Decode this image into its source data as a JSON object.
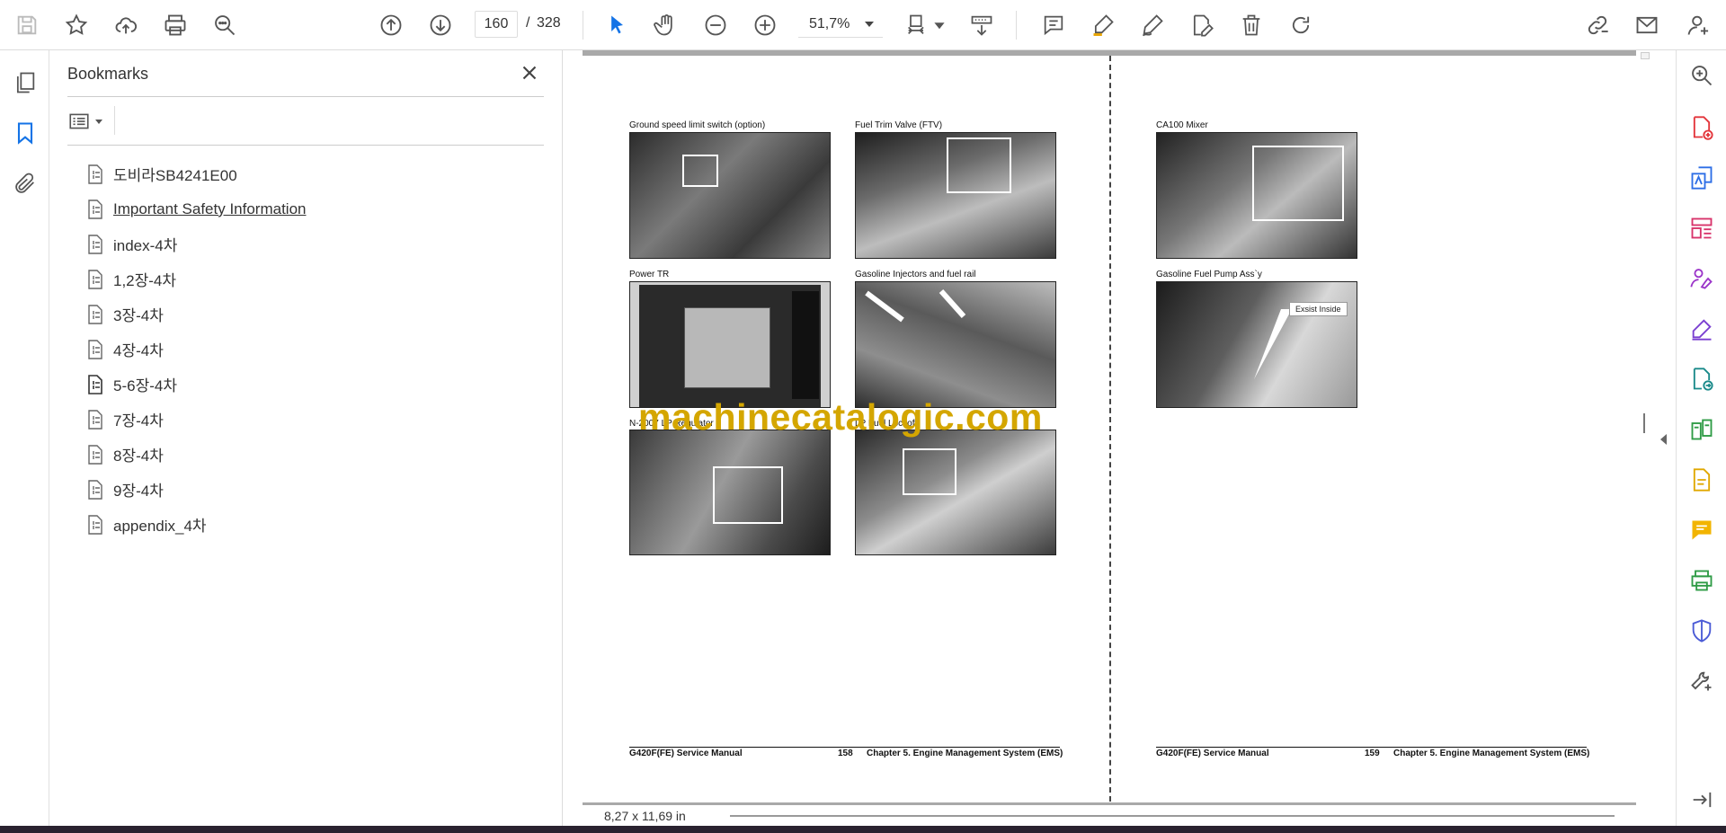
{
  "toolbar": {
    "current_page": "160",
    "page_separator": "/",
    "total_pages": "328",
    "zoom": "51,7%"
  },
  "bookmarks": {
    "title": "Bookmarks",
    "items": [
      {
        "label": "도비라SB4241E00"
      },
      {
        "label": "Important Safety Information"
      },
      {
        "label": "index-4차"
      },
      {
        "label": "1,2장-4차"
      },
      {
        "label": "3장-4차"
      },
      {
        "label": "4장-4차"
      },
      {
        "label": "5-6장-4차"
      },
      {
        "label": "7장-4차"
      },
      {
        "label": "8장-4차"
      },
      {
        "label": "9장-4차"
      },
      {
        "label": "appendix_4차"
      }
    ]
  },
  "document": {
    "left_page": {
      "captions": [
        "Ground speed limit switch (option)",
        "Fuel Trim Valve (FTV)",
        "Power TR",
        "Gasoline Injectors and fuel rail",
        "N-2007 LP Regulator",
        "LP Fuel Lockoff"
      ],
      "footer": {
        "manual": "G420F(FE) Service Manual",
        "page": "158",
        "chapter": "Chapter 5. Engine Management System (EMS)"
      }
    },
    "right_page": {
      "captions": [
        "CA100 Mixer",
        "Gasoline Fuel Pump Ass`y"
      ],
      "callout": "Exsist Inside",
      "footer": {
        "manual": "G420F(FE) Service Manual",
        "page": "159",
        "chapter": "Chapter 5. Engine Management System (EMS)"
      }
    },
    "watermark": "machinecatalogic.com"
  },
  "status": {
    "page_size": "8,27 x 11,69 in"
  },
  "colors": {
    "accent_blue": "#1473e6",
    "watermark": "#d4a600"
  }
}
